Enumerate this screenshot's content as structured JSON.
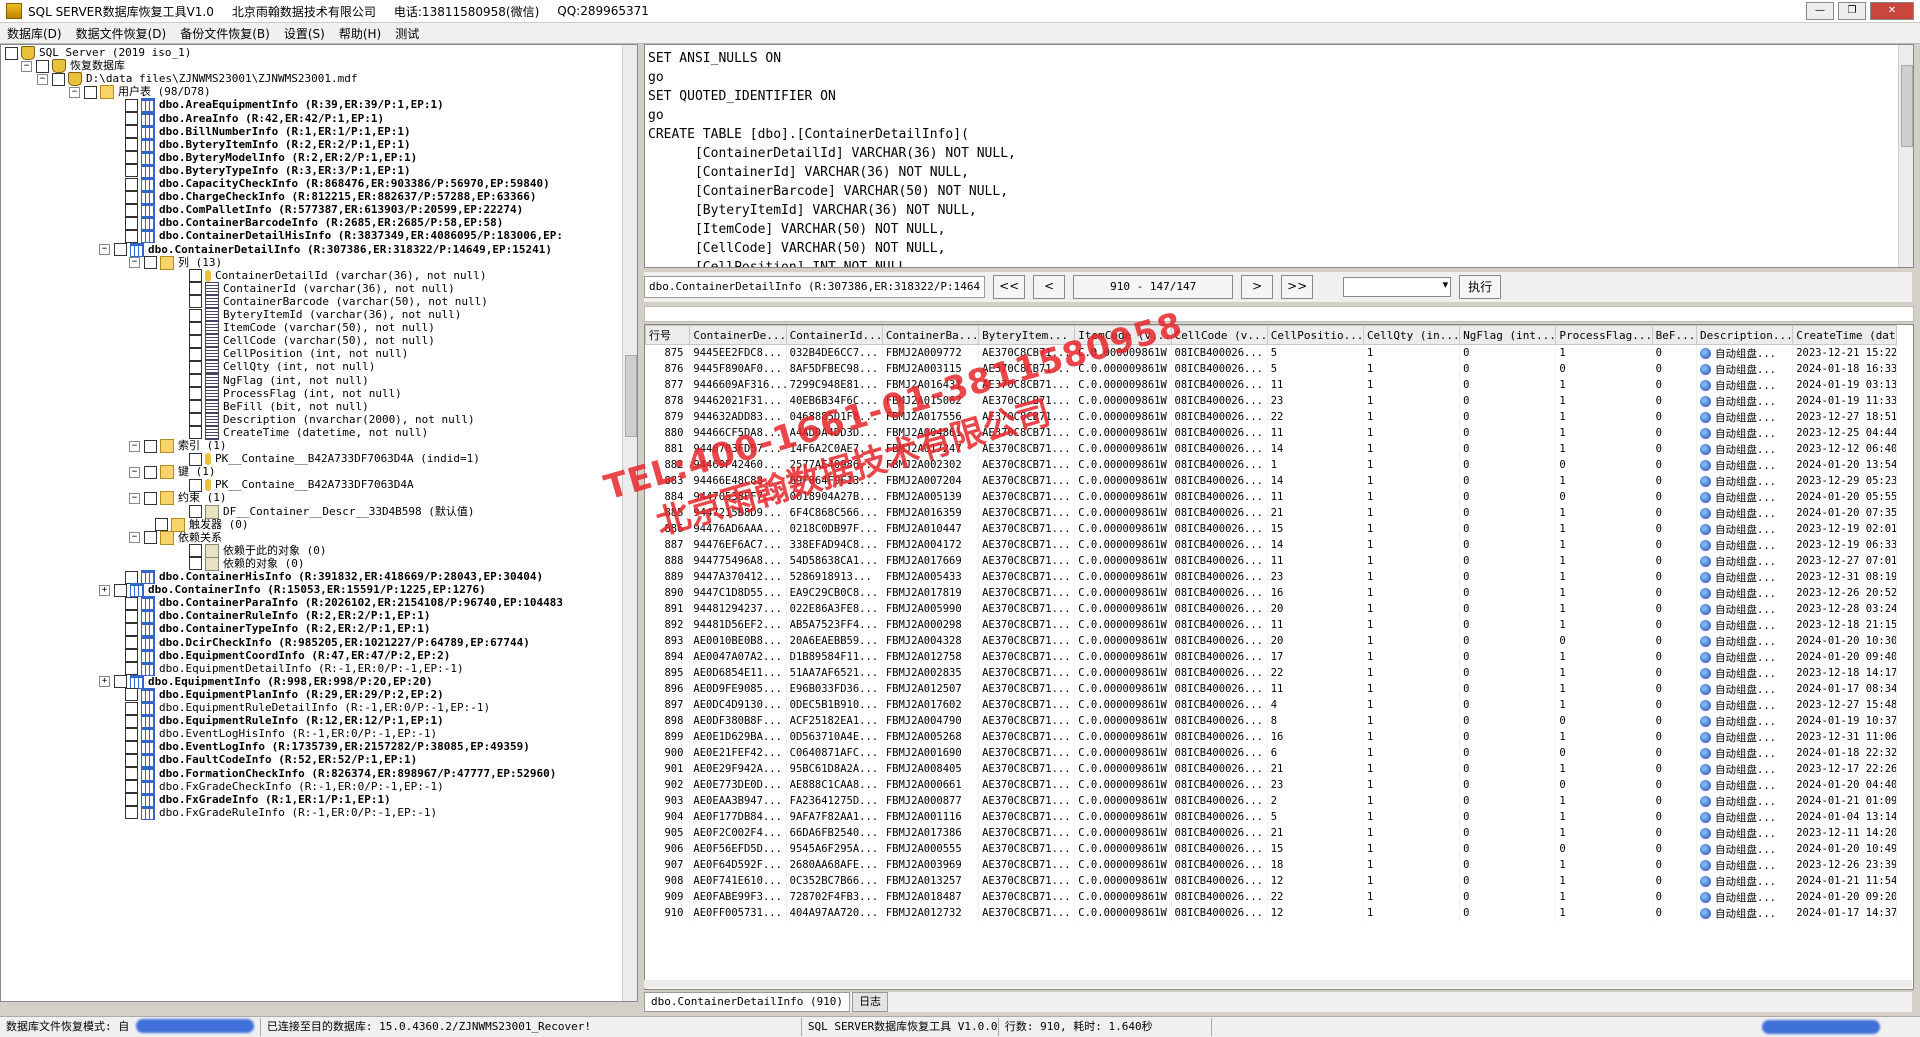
{
  "titlebar": {
    "app_title": "SQL SERVER数据库恢复工具V1.0",
    "company": "北京雨翰数据技术有限公司",
    "phone": "电话:13811580958(微信)",
    "qq": "QQ:289965371"
  },
  "menu": [
    "数据库(D)",
    "数据文件恢复(D)",
    "备份文件恢复(B)",
    "设置(S)",
    "帮助(H)",
    "测试"
  ],
  "tree": {
    "root": "SQL Server (2019 iso_1)",
    "recover_db": "恢复数据库",
    "file": "D:\\data files\\ZJNWMS23001\\ZJNWMS23001.mdf",
    "user_tables": "用户表 (98/D78)",
    "tables_top": [
      {
        "label": "dbo.AreaEquipmentInfo (R:39,ER:39/P:1,EP:1)",
        "bold": true
      },
      {
        "label": "dbo.AreaInfo (R:42,ER:42/P:1,EP:1)",
        "bold": true
      },
      {
        "label": "dbo.BillNumberInfo (R:1,ER:1/P:1,EP:1)",
        "bold": true
      },
      {
        "label": "dbo.ByteryItemInfo (R:2,ER:2/P:1,EP:1)",
        "bold": true
      },
      {
        "label": "dbo.ByteryModelInfo (R:2,ER:2/P:1,EP:1)",
        "bold": true
      },
      {
        "label": "dbo.ByteryTypeInfo (R:3,ER:3/P:1,EP:1)",
        "bold": true
      },
      {
        "label": "dbo.CapacityCheckInfo (R:868476,ER:903386/P:56970,EP:59840)",
        "bold": true
      },
      {
        "label": "dbo.ChargeCheckInfo (R:812215,ER:882637/P:57288,EP:63366)",
        "bold": true
      },
      {
        "label": "dbo.ComPalletInfo (R:577387,ER:613903/P:20599,EP:22274)",
        "bold": true
      },
      {
        "label": "dbo.ContainerBarcodeInfo (R:2685,ER:2685/P:58,EP:58)",
        "bold": true
      },
      {
        "label": "dbo.ContainerDetailHisInfo (R:3837349,ER:4086095/P:183006,EP:",
        "bold": true
      },
      {
        "label": "dbo.ContainerDetailInfo (R:307386,ER:318322/P:14649,EP:15241)",
        "bold": true
      }
    ],
    "columns_folder": "列 (13)",
    "columns": [
      "ContainerDetailId (varchar(36), not null)",
      "ContainerId (varchar(36), not null)",
      "ContainerBarcode (varchar(50), not null)",
      "ByteryItemId (varchar(36), not null)",
      "ItemCode (varchar(50), not null)",
      "CellCode (varchar(50), not null)",
      "CellPosition (int, not null)",
      "CellQty (int, not null)",
      "NgFlag (int, not null)",
      "ProcessFlag (int, not null)",
      "BeFill (bit, not null)",
      "Description (nvarchar(2000), not null)",
      "CreateTime (datetime, not null)"
    ],
    "index_folder": "索引 (1)",
    "index_item": "PK__Containe__B42A733DF7063D4A (indid=1)",
    "key_folder": "键 (1)",
    "key_item": "PK__Containe__B42A733DF7063D4A",
    "constraint_folder": "约束 (1)",
    "constraint_item": "DF__Container__Descr__33D4B598 (默认值)",
    "trigger_folder": "触发器 (0)",
    "dep_folder": "依赖关系",
    "dep_on": "依赖于此的对象 (0)",
    "dep_by": "依赖的对象 (0)",
    "tables_bottom": [
      {
        "label": "dbo.ContainerHisInfo (R:391832,ER:418669/P:28043,EP:30404)",
        "bold": true
      },
      {
        "label": "dbo.ContainerInfo (R:15053,ER:15591/P:1225,EP:1276)",
        "bold": true
      },
      {
        "label": "dbo.ContainerParaInfo (R:2026102,ER:2154108/P:96740,EP:104483",
        "bold": true
      },
      {
        "label": "dbo.ContainerRuleInfo (R:2,ER:2/P:1,EP:1)",
        "bold": true
      },
      {
        "label": "dbo.ContainerTypeInfo (R:2,ER:2/P:1,EP:1)",
        "bold": true
      },
      {
        "label": "dbo.DcirCheckInfo (R:985205,ER:1021227/P:64789,EP:67744)",
        "bold": true
      },
      {
        "label": "dbo.EquipmentCoordInfo (R:47,ER:47/P:2,EP:2)",
        "bold": true
      },
      {
        "label": "dbo.EquipmentDetailInfo (R:-1,ER:0/P:-1,EP:-1)",
        "bold": false
      },
      {
        "label": "dbo.EquipmentInfo (R:998,ER:998/P:20,EP:20)",
        "bold": true
      },
      {
        "label": "dbo.EquipmentPlanInfo (R:29,ER:29/P:2,EP:2)",
        "bold": true
      },
      {
        "label": "dbo.EquipmentRuleDetailInfo (R:-1,ER:0/P:-1,EP:-1)",
        "bold": false
      },
      {
        "label": "dbo.EquipmentRuleInfo (R:12,ER:12/P:1,EP:1)",
        "bold": true
      },
      {
        "label": "dbo.EventLogHisInfo (R:-1,ER:0/P:-1,EP:-1)",
        "bold": false
      },
      {
        "label": "dbo.EventLogInfo (R:1735739,ER:2157282/P:38085,EP:49359)",
        "bold": true
      },
      {
        "label": "dbo.FaultCodeInfo (R:52,ER:52/P:1,EP:1)",
        "bold": true
      },
      {
        "label": "dbo.FormationCheckInfo (R:826374,ER:898967/P:47777,EP:52960)",
        "bold": true
      },
      {
        "label": "dbo.FxGradeCheckInfo (R:-1,ER:0/P:-1,EP:-1)",
        "bold": false
      },
      {
        "label": "dbo.FxGradeInfo (R:1,ER:1/P:1,EP:1)",
        "bold": true
      },
      {
        "label": "dbo.FxGradeRuleInfo (R:-1,ER:0/P:-1,EP:-1)",
        "bold": false
      }
    ]
  },
  "sql_text": "SET ANSI_NULLS ON\ngo\nSET QUOTED_IDENTIFIER ON\ngo\nCREATE TABLE [dbo].[ContainerDetailInfo](\n      [ContainerDetailId] VARCHAR(36) NOT NULL,\n      [ContainerId] VARCHAR(36) NOT NULL,\n      [ContainerBarcode] VARCHAR(50) NOT NULL,\n      [ByteryItemId] VARCHAR(36) NOT NULL,\n      [ItemCode] VARCHAR(50) NOT NULL,\n      [CellCode] VARCHAR(50) NOT NULL,\n      [CellPosition] INT NOT NULL,",
  "toolbar": {
    "table_label": "dbo.ContainerDetailInfo (R:307386,ER:318322/P:1464",
    "first": "<<",
    "prev": "<",
    "page": "910 - 147/147",
    "next": ">",
    "last": ">>",
    "exec": "执行"
  },
  "grid": {
    "columns": [
      "行号",
      "ContainerDe...",
      "ContainerId...",
      "ContainerBa...",
      "ByteryItem...",
      "ItemCode (v...",
      "CellCode (v...",
      "CellPositio...",
      "CellQty (in...",
      "NgFlag (int...",
      "ProcessFlag...",
      "BeF...",
      "Description...",
      "CreateTime (datet..."
    ],
    "rows": [
      [
        "875",
        "9445EE2FDC8...",
        "032B4DE6CC7...",
        "FBMJ2A009772",
        "AE370C8CB71...",
        "C.0.000009861W",
        "08ICB400026...",
        "5",
        "1",
        "0",
        "1",
        "0",
        "自动组盘...",
        "2023-12-21 15:22:"
      ],
      [
        "876",
        "9445F890AF0...",
        "8AF5DFBEC98...",
        "FBMJ2A003115",
        "AE370C8CB71...",
        "C.0.000009861W",
        "08ICB400026...",
        "5",
        "1",
        "0",
        "0",
        "0",
        "自动组盘...",
        "2024-01-18 16:33:"
      ],
      [
        "877",
        "9446609AF316...",
        "7299C948E81...",
        "FBMJ2A016431",
        "AE370C8CB71...",
        "C.0.000009861W",
        "08ICB400026...",
        "11",
        "1",
        "0",
        "1",
        "0",
        "自动组盘...",
        "2024-01-19 03:13:"
      ],
      [
        "878",
        "94462021F31...",
        "40EB6B34F6C...",
        "FBMJ2A015062",
        "AE370C8CB71...",
        "C.0.000009861W",
        "08ICB400026...",
        "23",
        "1",
        "0",
        "1",
        "0",
        "自动组盘...",
        "2024-01-19 11:33:"
      ],
      [
        "879",
        "944632ADD83...",
        "0468885D1F8...",
        "FBMJ2A017556",
        "AE370C8CB71...",
        "C.0.000009861W",
        "08ICB400026...",
        "22",
        "1",
        "0",
        "1",
        "0",
        "自动组盘...",
        "2023-12-27 18:51:"
      ],
      [
        "880",
        "94466CF5DA8...",
        "A4ADDA4DD3D...",
        "FBMJ2A004861",
        "AE370C8CB71...",
        "C.0.000009861W",
        "08ICB400026...",
        "11",
        "1",
        "0",
        "1",
        "0",
        "自动组盘...",
        "2023-12-25 04:44:"
      ],
      [
        "881",
        "9446703FD57...",
        "14F6A2C0AE7...",
        "FBMJ2A017247",
        "AE370C8CB71...",
        "C.0.000009861W",
        "08ICB400026...",
        "14",
        "1",
        "0",
        "1",
        "0",
        "自动组盘...",
        "2023-12-12 06:40:"
      ],
      [
        "882",
        "94469F42460...",
        "2577AE40986...",
        "FBMJ2A002302",
        "AE370C8CB71...",
        "C.0.000009861W",
        "08ICB400026...",
        "1",
        "1",
        "0",
        "0",
        "0",
        "自动组盘...",
        "2024-01-20 13:54:"
      ],
      [
        "883",
        "94466E48C88...",
        "69F864F9F13...",
        "FBMJ2A007204",
        "AE370C8CB71...",
        "C.0.000009861W",
        "08ICB400026...",
        "14",
        "1",
        "0",
        "1",
        "0",
        "自动组盘...",
        "2023-12-29 05:23:"
      ],
      [
        "884",
        "94470538FF7...",
        "0018904A27B...",
        "FBMJ2A005139",
        "AE370C8CB71...",
        "C.0.000009861W",
        "08ICB400026...",
        "11",
        "1",
        "0",
        "0",
        "0",
        "自动组盘...",
        "2024-01-20 05:55:"
      ],
      [
        "885",
        "9447215B8D9...",
        "6F4C868C566...",
        "FBMJ2A016359",
        "AE370C8CB71...",
        "C.0.000009861W",
        "08ICB400026...",
        "21",
        "1",
        "0",
        "1",
        "0",
        "自动组盘...",
        "2024-01-20 07:35:"
      ],
      [
        "886",
        "94476AD6AAA...",
        "0218C0DB97F...",
        "FBMJ2A010447",
        "AE370C8CB71...",
        "C.0.000009861W",
        "08ICB400026...",
        "15",
        "1",
        "0",
        "1",
        "0",
        "自动组盘...",
        "2023-12-19 02:01:"
      ],
      [
        "887",
        "94476EF6AC7...",
        "338EFAD94C8...",
        "FBMJ2A004172",
        "AE370C8CB71...",
        "C.0.000009861W",
        "08ICB400026...",
        "14",
        "1",
        "0",
        "1",
        "0",
        "自动组盘...",
        "2023-12-19 06:33:"
      ],
      [
        "888",
        "944775496A8...",
        "54D58638CA1...",
        "FBMJ2A017669",
        "AE370C8CB71...",
        "C.0.000009861W",
        "08ICB400026...",
        "11",
        "1",
        "0",
        "1",
        "0",
        "自动组盘...",
        "2023-12-27 07:01:"
      ],
      [
        "889",
        "9447A370412...",
        "5286918913...",
        "FBMJ2A005433",
        "AE370C8CB71...",
        "C.0.000009861W",
        "08ICB400026...",
        "23",
        "1",
        "0",
        "1",
        "0",
        "自动组盘...",
        "2023-12-31 08:19:"
      ],
      [
        "890",
        "9447C1D8D55...",
        "EA9C29CB0C8...",
        "FBMJ2A017819",
        "AE370C8CB71...",
        "C.0.000009861W",
        "08ICB400026...",
        "16",
        "1",
        "0",
        "1",
        "0",
        "自动组盘...",
        "2023-12-26 20:52:"
      ],
      [
        "891",
        "94481294237...",
        "022E86A3FE8...",
        "FBMJ2A005990",
        "AE370C8CB71...",
        "C.0.000009861W",
        "08ICB400026...",
        "20",
        "1",
        "0",
        "1",
        "0",
        "自动组盘...",
        "2023-12-28 03:24:"
      ],
      [
        "892",
        "94481D56EF2...",
        "AB5A7523FF4...",
        "FBMJ2A000298",
        "AE370C8CB71...",
        "C.0.000009861W",
        "08ICB400026...",
        "11",
        "1",
        "0",
        "1",
        "0",
        "自动组盘...",
        "2023-12-18 21:15:"
      ],
      [
        "893",
        "AE0010BE0B8...",
        "20A6EAEBB59...",
        "FBMJ2A004328",
        "AE370C8CB71...",
        "C.0.000009861W",
        "08ICB400026...",
        "20",
        "1",
        "0",
        "0",
        "0",
        "自动组盘...",
        "2024-01-20 10:30:"
      ],
      [
        "894",
        "AE0047A07A2...",
        "D1B89584F11...",
        "FBMJ2A012758",
        "AE370C8CB71...",
        "C.0.000009861W",
        "08ICB400026...",
        "17",
        "1",
        "0",
        "1",
        "0",
        "自动组盘...",
        "2024-01-20 09:40:"
      ],
      [
        "895",
        "AE0D6854E11...",
        "51AA7AF6521...",
        "FBMJ2A002835",
        "AE370C8CB71...",
        "C.0.000009861W",
        "08ICB400026...",
        "22",
        "1",
        "0",
        "1",
        "0",
        "自动组盘...",
        "2023-12-18 14:17:"
      ],
      [
        "896",
        "AE0D9FE9085...",
        "E96B033FD36...",
        "FBMJ2A012507",
        "AE370C8CB71...",
        "C.0.000009861W",
        "08ICB400026...",
        "11",
        "1",
        "0",
        "1",
        "0",
        "自动组盘...",
        "2024-01-17 08:34:"
      ],
      [
        "897",
        "AE0DC4D9130...",
        "0DEC5B1B910...",
        "FBMJ2A017602",
        "AE370C8CB71...",
        "C.0.000009861W",
        "08ICB400026...",
        "4",
        "1",
        "0",
        "1",
        "0",
        "自动组盘...",
        "2023-12-27 15:48:"
      ],
      [
        "898",
        "AE0DF380B8F...",
        "ACF25182EA1...",
        "FBMJ2A004790",
        "AE370C8CB71...",
        "C.0.000009861W",
        "08ICB400026...",
        "8",
        "1",
        "0",
        "0",
        "0",
        "自动组盘...",
        "2024-01-19 10:37:"
      ],
      [
        "899",
        "AE0E1D629BA...",
        "0D563710A4E...",
        "FBMJ2A005268",
        "AE370C8CB71...",
        "C.0.000009861W",
        "08ICB400026...",
        "16",
        "1",
        "0",
        "1",
        "0",
        "自动组盘...",
        "2023-12-31 11:06:"
      ],
      [
        "900",
        "AE0E21FEF42...",
        "C0640871AFC...",
        "FBMJ2A001690",
        "AE370C8CB71...",
        "C.0.000009861W",
        "08ICB400026...",
        "6",
        "1",
        "0",
        "0",
        "0",
        "自动组盘...",
        "2024-01-18 22:32:"
      ],
      [
        "901",
        "AE0E29F942A...",
        "95BC61D8A2A...",
        "FBMJ2A008405",
        "AE370C8CB71...",
        "C.0.000009861W",
        "08ICB400026...",
        "21",
        "1",
        "0",
        "1",
        "0",
        "自动组盘...",
        "2023-12-17 22:26:"
      ],
      [
        "902",
        "AE0E773DE0D...",
        "AE888C1CAA8...",
        "FBMJ2A000661",
        "AE370C8CB71...",
        "C.0.000009861W",
        "08ICB400026...",
        "23",
        "1",
        "0",
        "0",
        "0",
        "自动组盘...",
        "2024-01-20 04:40:"
      ],
      [
        "903",
        "AE0EAA3B947...",
        "FA23641275D...",
        "FBMJ2A000877",
        "AE370C8CB71...",
        "C.0.000009861W",
        "08ICB400026...",
        "2",
        "1",
        "0",
        "1",
        "0",
        "自动组盘...",
        "2024-01-21 01:09:"
      ],
      [
        "904",
        "AE0F177DB84...",
        "9AFA7F82AA1...",
        "FBMJ2A001116",
        "AE370C8CB71...",
        "C.0.000009861W",
        "08ICB400026...",
        "5",
        "1",
        "0",
        "1",
        "0",
        "自动组盘...",
        "2024-01-04 13:14:"
      ],
      [
        "905",
        "AE0F2C002F4...",
        "66DA6FB2540...",
        "FBMJ2A017386",
        "AE370C8CB71...",
        "C.0.000009861W",
        "08ICB400026...",
        "21",
        "1",
        "0",
        "1",
        "0",
        "自动组盘...",
        "2023-12-11 14:20:"
      ],
      [
        "906",
        "AE0F56EFD5D...",
        "9545A6F295A...",
        "FBMJ2A000555",
        "AE370C8CB71...",
        "C.0.000009861W",
        "08ICB400026...",
        "15",
        "1",
        "0",
        "0",
        "0",
        "自动组盘...",
        "2024-01-20 10:49:"
      ],
      [
        "907",
        "AE0F64D592F...",
        "2680AA68AFE...",
        "FBMJ2A003969",
        "AE370C8CB71...",
        "C.0.000009861W",
        "08ICB400026...",
        "18",
        "1",
        "0",
        "1",
        "0",
        "自动组盘...",
        "2023-12-26 23:39:"
      ],
      [
        "908",
        "AE0F741E610...",
        "0C352BC7B66...",
        "FBMJ2A013257",
        "AE370C8CB71...",
        "C.0.000009861W",
        "08ICB400026...",
        "12",
        "1",
        "0",
        "1",
        "0",
        "自动组盘...",
        "2024-01-21 11:54:"
      ],
      [
        "909",
        "AE0FABE99F3...",
        "728702F4FB3...",
        "FBMJ2A018487",
        "AE370C8CB71...",
        "C.0.000009861W",
        "08ICB400026...",
        "22",
        "1",
        "0",
        "1",
        "0",
        "自动组盘...",
        "2024-01-20 09:20:"
      ],
      [
        "910",
        "AE0FF005731...",
        "404A97AA720...",
        "FBMJ2A012732",
        "AE370C8CB71...",
        "C.0.000009861W",
        "08ICB400026...",
        "12",
        "1",
        "0",
        "1",
        "0",
        "自动组盘...",
        "2024-01-17 14:37:"
      ]
    ]
  },
  "tabs": [
    "dbo.ContainerDetailInfo (910)",
    "日志"
  ],
  "status": {
    "mode": "数据库文件恢复模式: 自",
    "connected": "已连接至目的数据库: 15.0.4360.2/ZJNWMS23001_Recover!",
    "tool": "SQL SERVER数据库恢复工具 V1.0.0",
    "rows": "行数: 910, 耗时: 1.640秒"
  },
  "watermark": {
    "line1": "TEL:400-1661-01-3811580958",
    "line2": "北京雨翰数据技术有限公司"
  },
  "colors": {
    "watermark": "#e8272c",
    "tree_bg": "#ffffff",
    "chrome": "#d4d0c8"
  }
}
